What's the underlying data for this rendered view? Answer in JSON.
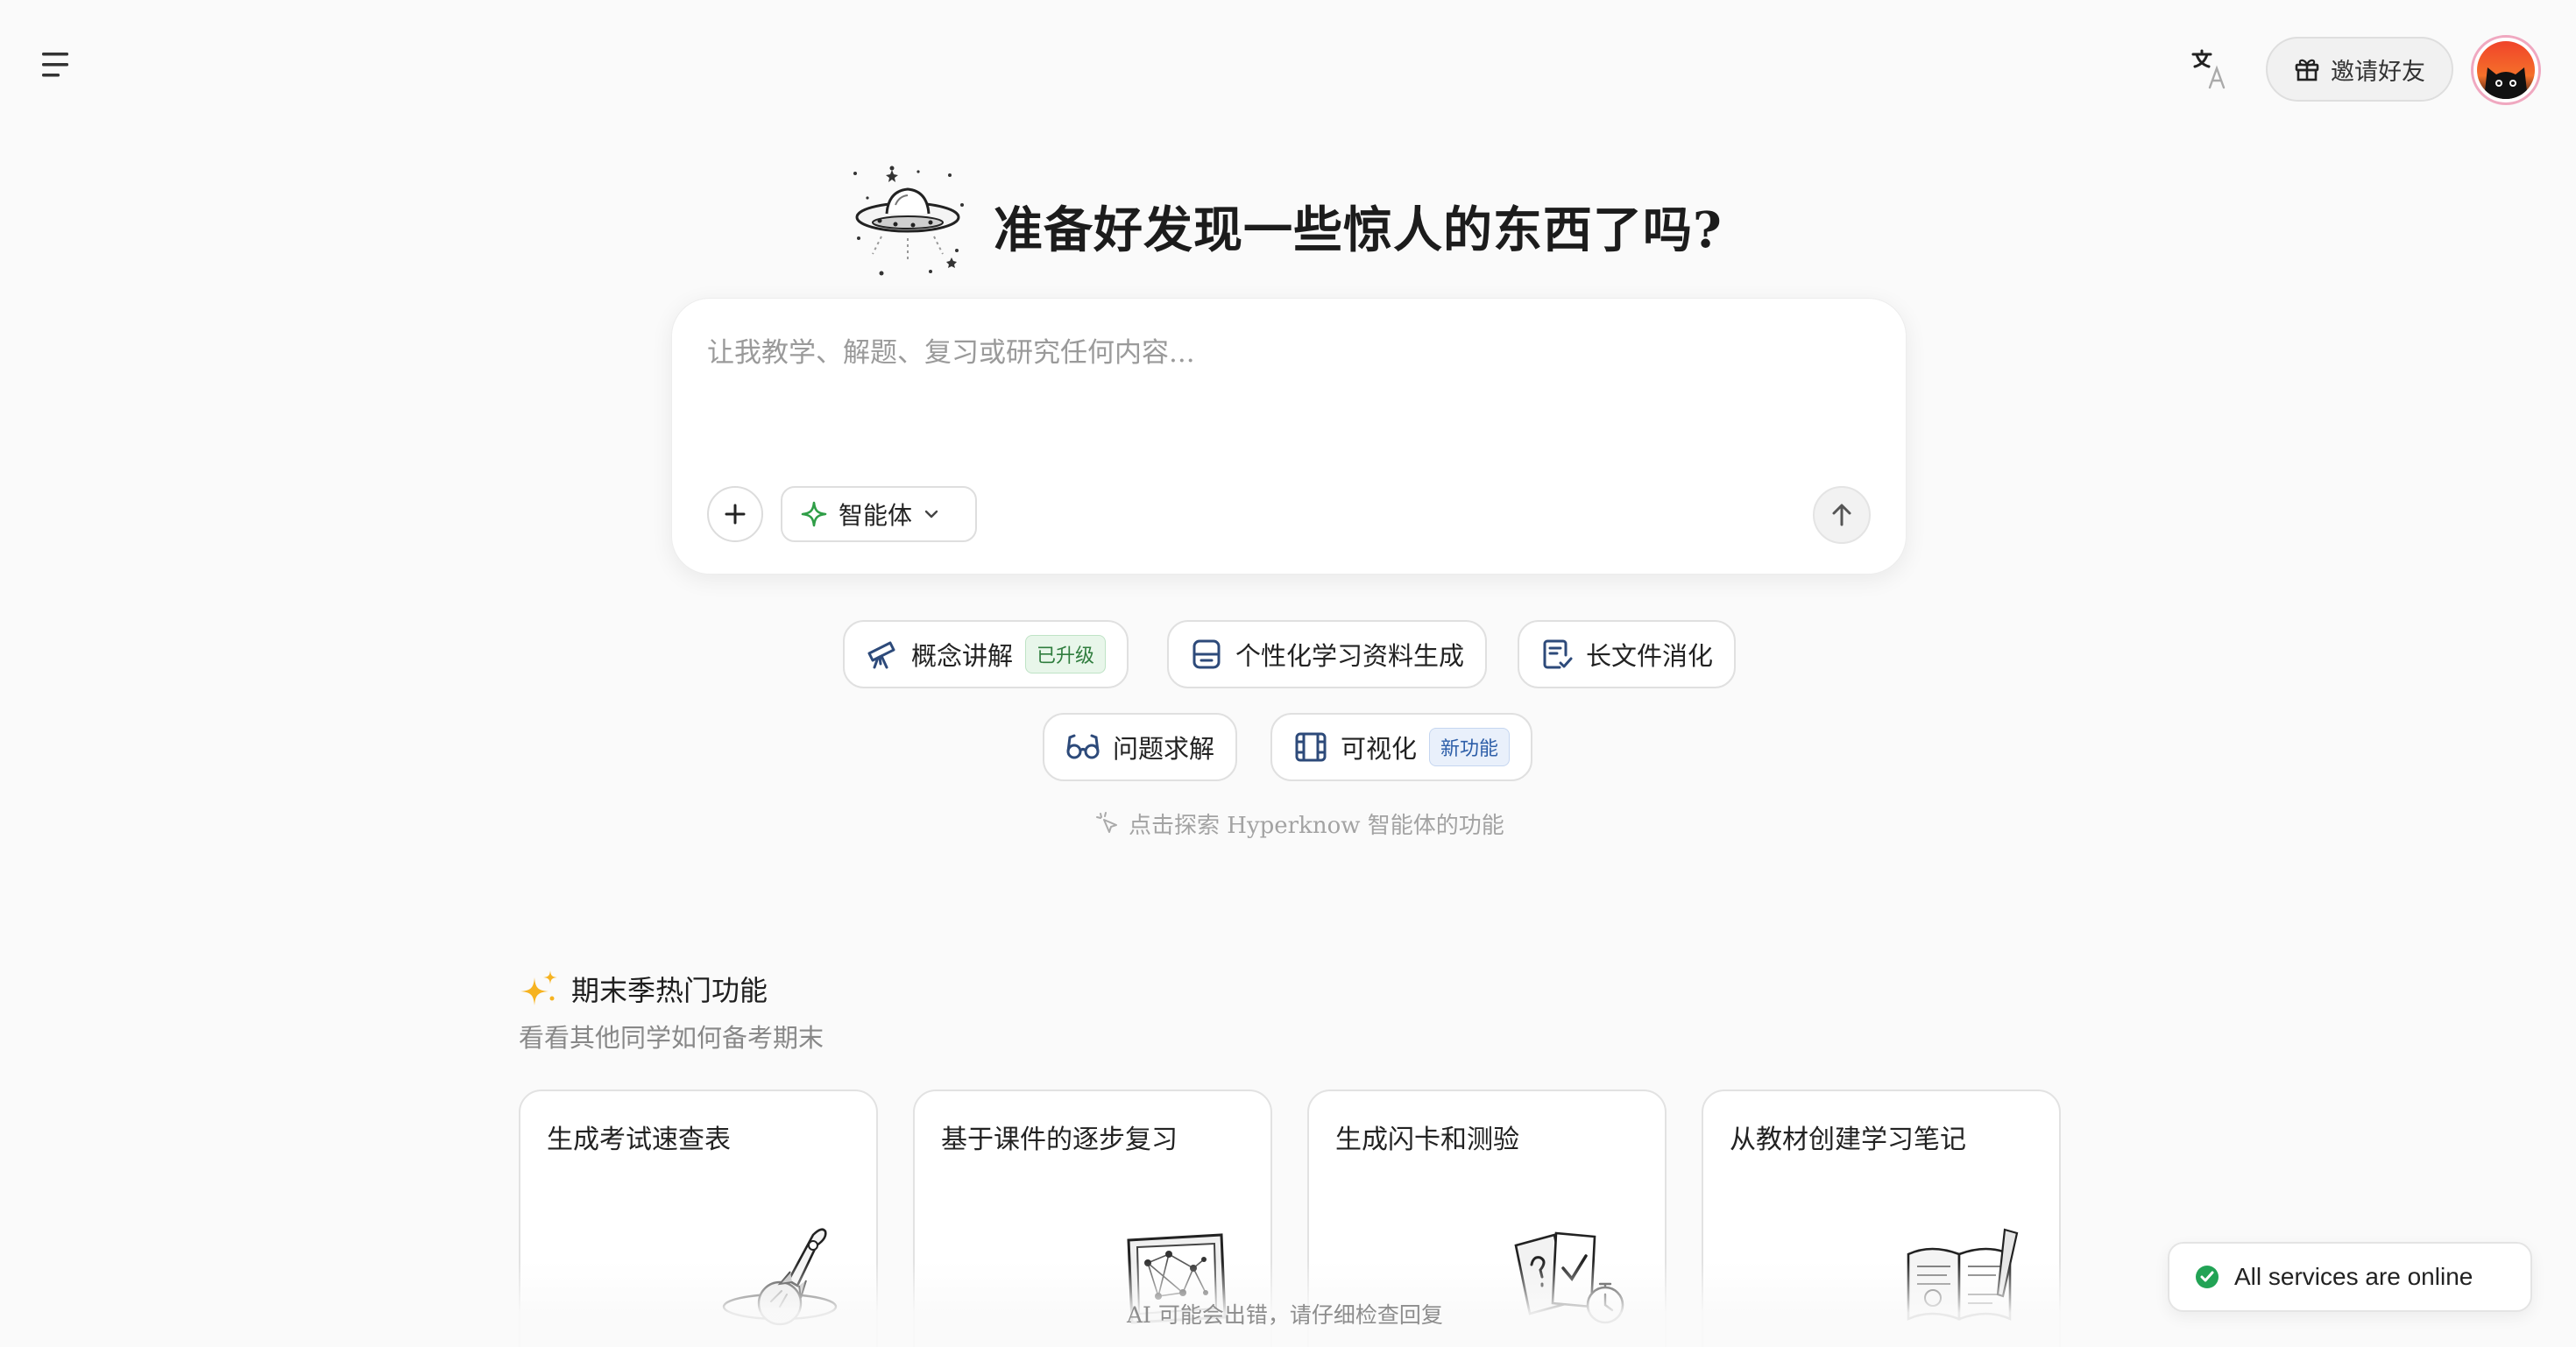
{
  "colors": {
    "accent_green": "#2f9e47",
    "badge_blue": "#2d5ea8",
    "status_green": "#22a355"
  },
  "header": {
    "menu_icon": "menu-icon",
    "translate_icon": "translate-icon",
    "invite_label": "邀请好友",
    "invite_icon": "gift-icon"
  },
  "hero": {
    "title": "准备好发现一些惊人的东西了吗?",
    "illustration": "ufo-illustration"
  },
  "composer": {
    "placeholder": "让我教学、解题、复习或研究任何内容...",
    "agent_label": "智能体",
    "agent_icon": "sparkle-icon",
    "add_icon": "plus-icon",
    "send_icon": "arrow-up-icon"
  },
  "chips": [
    {
      "label": "概念讲解",
      "icon": "telescope-icon",
      "badge": "已升级"
    },
    {
      "label": "个性化学习资料生成",
      "icon": "document-stack-icon"
    },
    {
      "label": "长文件消化",
      "icon": "file-check-icon"
    },
    {
      "label": "问题求解",
      "icon": "glasses-icon"
    },
    {
      "label": "可视化",
      "icon": "video-icon",
      "badge": "新功能"
    }
  ],
  "explore_hint": "点击探索 Hyperknow 智能体的功能",
  "section": {
    "title": "期末季热门功能",
    "subtitle": "看看其他同学如何备考期末",
    "icon": "sparkles-icon",
    "cards": [
      {
        "title": "生成考试速查表",
        "illustration": "rocket-planet-illustration"
      },
      {
        "title": "基于课件的逐步复习",
        "illustration": "tablet-network-illustration"
      },
      {
        "title": "生成闪卡和测验",
        "illustration": "flashcards-timer-illustration"
      },
      {
        "title": "从教材创建学习笔记",
        "illustration": "open-book-illustration"
      }
    ]
  },
  "disclaimer": "AI 可能会出错，请仔细检查回复",
  "status": {
    "label": "All services are online",
    "icon": "check-circle-icon"
  }
}
